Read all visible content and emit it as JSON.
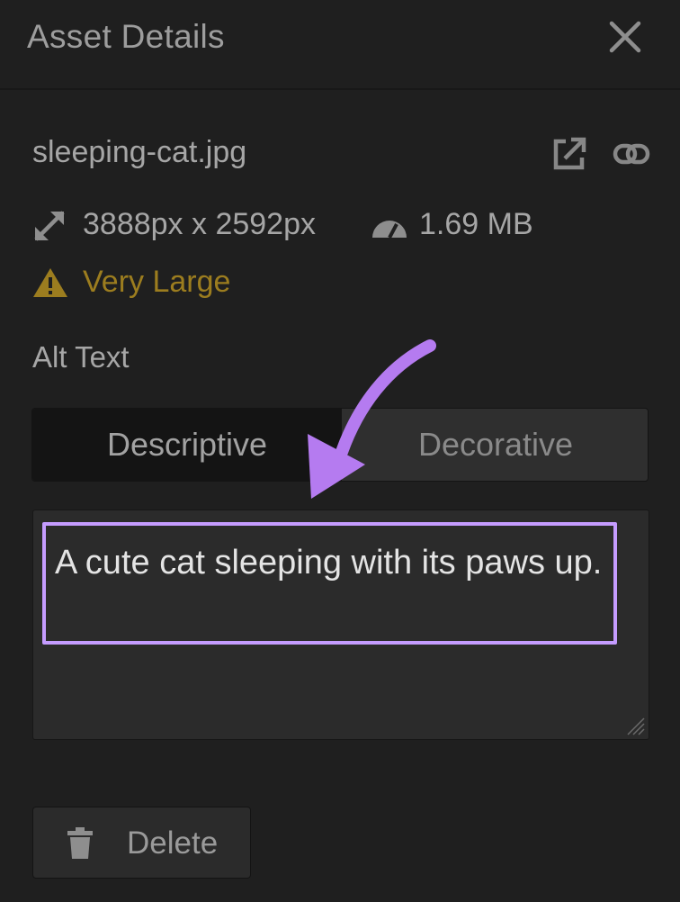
{
  "header": {
    "title": "Asset Details",
    "close_icon": "close-icon"
  },
  "asset": {
    "filename": "sleeping-cat.jpg",
    "open_icon": "external-link-icon",
    "link_icon": "link-icon",
    "dimensions": "3888px x 2592px",
    "dimensions_icon": "resize-arrows-icon",
    "file_size": "1.69 MB",
    "file_size_icon": "gauge-icon",
    "warning_text": "Very Large",
    "warning_icon": "warning-triangle-icon",
    "warning_color": "#9c7d1f"
  },
  "alt_text": {
    "label": "Alt Text",
    "modes": [
      "Descriptive",
      "Decorative"
    ],
    "selected_mode": "Descriptive",
    "value": "A cute cat sleeping with its paws up."
  },
  "annotation": {
    "arrow_icon": "curved-arrow-icon",
    "color": "#c59cff"
  },
  "actions": {
    "delete_label": "Delete",
    "delete_icon": "trash-icon"
  }
}
